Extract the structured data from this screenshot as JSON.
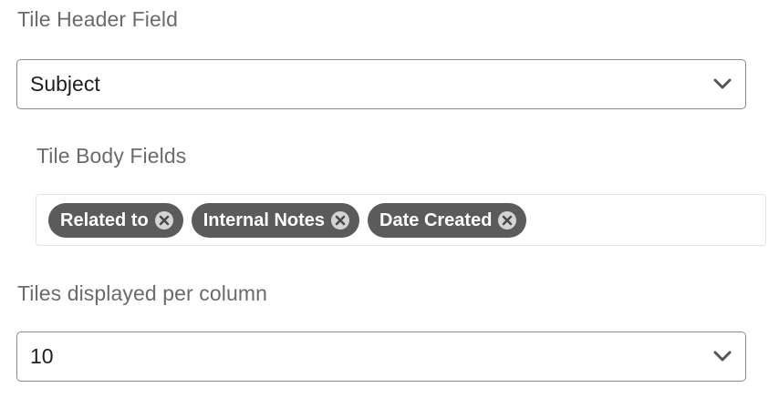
{
  "tile_header": {
    "label": "Tile Header Field",
    "value": "Subject"
  },
  "tile_body": {
    "label": "Tile Body Fields",
    "chips": [
      {
        "label": "Related to"
      },
      {
        "label": "Internal Notes"
      },
      {
        "label": "Date Created"
      }
    ]
  },
  "tiles_per_column": {
    "label": "Tiles displayed per column",
    "value": "10"
  },
  "icons": {
    "dropdown": "chevron-down-icon",
    "chip_remove": "close-circle-icon"
  },
  "colors": {
    "chip_background": "#5b5b5b",
    "label_text": "#6b6b6b",
    "select_border": "#8a8a8a"
  }
}
